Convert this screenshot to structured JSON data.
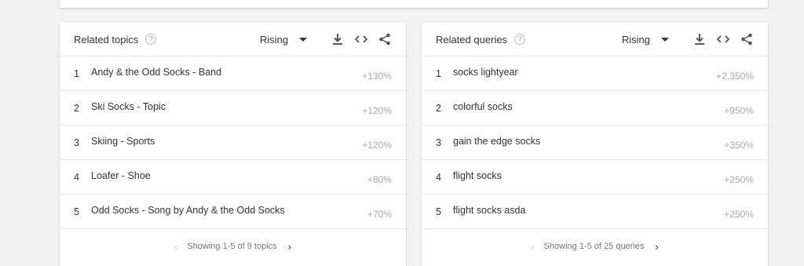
{
  "related_topics": {
    "title": "Related topics",
    "help_icon": "help-circle-icon",
    "dropdown_value": "Rising",
    "rows": [
      {
        "rank": "1",
        "label": "Andy & the Odd Socks - Band",
        "value": "+130%"
      },
      {
        "rank": "2",
        "label": "Ski Socks - Topic",
        "value": "+120%"
      },
      {
        "rank": "3",
        "label": "Skiing - Sports",
        "value": "+120%"
      },
      {
        "rank": "4",
        "label": "Loafer - Shoe",
        "value": "+80%"
      },
      {
        "rank": "5",
        "label": "Odd Socks - Song by Andy & the Odd Socks",
        "value": "+70%"
      }
    ],
    "pagination": "Showing 1-5 of 9 topics"
  },
  "related_queries": {
    "title": "Related queries",
    "help_icon": "help-circle-icon",
    "dropdown_value": "Rising",
    "rows": [
      {
        "rank": "1",
        "label": "socks lightyear",
        "value": "+2,350%"
      },
      {
        "rank": "2",
        "label": "colorful socks",
        "value": "+950%"
      },
      {
        "rank": "3",
        "label": "gain the edge socks",
        "value": "+350%"
      },
      {
        "rank": "4",
        "label": "flight socks",
        "value": "+250%"
      },
      {
        "rank": "5",
        "label": "flight socks asda",
        "value": "+250%"
      }
    ],
    "pagination": "Showing 1-5 of 25 queries"
  },
  "colors": {
    "accent_text": "#333333",
    "muted_value": "#aaaaaa",
    "divider": "#e6e6e6"
  }
}
